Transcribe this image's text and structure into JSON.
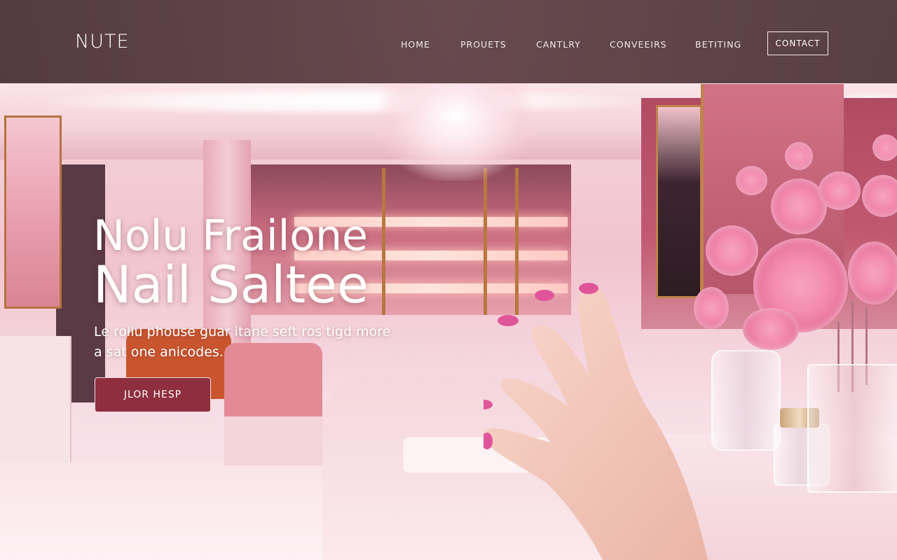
{
  "brand": {
    "logo": "NUTE"
  },
  "nav": {
    "items": [
      "HOME",
      "PROUETS",
      "CANTLRY",
      "CONVEEIRS",
      "BETITING"
    ],
    "contact_label": "CONTACT"
  },
  "hero": {
    "title_line1": "Nolu Frailone",
    "title_line2": "Nail  Saltee",
    "description": "Le rollu phouse guar itane seft ros tigd more a sat one anicodes.",
    "cta_label": "JLOR HESP"
  },
  "colors": {
    "header_bg": "#4f3538",
    "cta_bg": "#8e2e3f",
    "accent_pink": "#f38cb0"
  }
}
